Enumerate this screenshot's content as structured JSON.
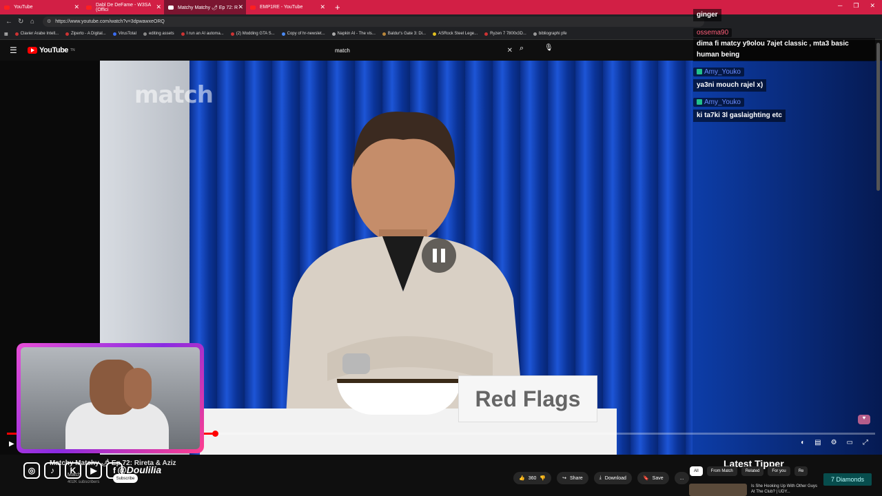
{
  "browser": {
    "tabs": [
      {
        "label": "YouTube",
        "active": false
      },
      {
        "label": "Dabl De DeFame - W3SA (Offici",
        "active": false
      },
      {
        "label": "Matchy Matchy 🌶 Ep 72: R",
        "active": true
      },
      {
        "label": "EMP1RE - YouTube",
        "active": false
      }
    ],
    "new_tab": "+",
    "url": "https://www.youtube.com/watch?v=3dpwawxeORQ",
    "bookmarks": [
      "Clavier Arabe Intell...",
      "Ziperto - A Digital...",
      "VirusTotal",
      "editing assets",
      "I run an AI automa...",
      "(2) Modding GTA S...",
      "Copy of hr-newslet...",
      "Napkin AI - The vis...",
      "Baldur's Gate 3: Di...",
      "ASRock Steel Lege...",
      "Ryzen 7 7800x3D...",
      "bibliographi pfe"
    ]
  },
  "youtube": {
    "logo_text": "YouTube",
    "logo_sup": "TN",
    "search_value": "match"
  },
  "video": {
    "watermark": "match",
    "sign_text": "Red Flags",
    "progress": 0.24
  },
  "chat": {
    "top_partial": "ginger",
    "messages": [
      {
        "user": "ossema90",
        "style": "red",
        "text": "dima fi matcy y9olou 7ajet classic , mta3 basic human being"
      },
      {
        "user": "Amy_Youko",
        "style": "blue",
        "text": "ya3ni mouch rajel x)"
      },
      {
        "user": "Amy_Youko",
        "style": "blue",
        "text": "ki ta7ki 3l gaslaighting etc"
      }
    ]
  },
  "below": {
    "video_title": "Matchy Matchy 🌶 Ep 72: Rireta & Aziz",
    "overlay_handle": "@Doulilia",
    "channel": "Match",
    "subscribers": "402K subscribers",
    "subscribe": "Subscribe",
    "like_count": "360",
    "share": "Share",
    "download": "Download",
    "save": "Save",
    "more": "...",
    "filters": [
      "All",
      "From Match",
      "Related",
      "For you",
      "Re"
    ],
    "latest_tipper": "Latest Tipper",
    "diamonds": "7 Diamonds",
    "rec_title": "Is She Hooking Up With Other Guys At The Club? | UDY..."
  }
}
